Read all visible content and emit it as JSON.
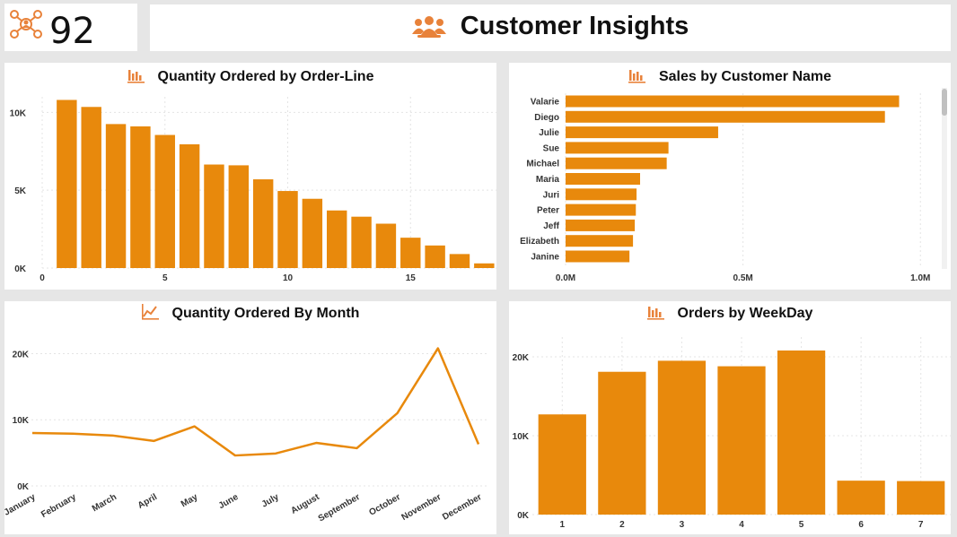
{
  "header": {
    "kpi_value": "92",
    "title": "Customer Insights"
  },
  "colors": {
    "bar": "#e8890c",
    "grid": "#e4e4e4",
    "text": "#333333",
    "icon": "#e8823a"
  },
  "icons": {
    "kpi": "network-people-icon",
    "title": "team-icon",
    "chart": "bar-chart-icon",
    "line": "line-chart-icon"
  },
  "chart_data": [
    {
      "id": "qty-orderline",
      "type": "bar",
      "title": "Quantity Ordered by Order-Line",
      "x": [
        1,
        2,
        3,
        4,
        5,
        6,
        7,
        8,
        9,
        10,
        11,
        12,
        13,
        14,
        15,
        16,
        17,
        18
      ],
      "values": [
        10800,
        10350,
        9250,
        9100,
        8550,
        7950,
        6650,
        6600,
        5700,
        4950,
        4450,
        3700,
        3300,
        2850,
        1950,
        1450,
        900,
        300
      ],
      "xlim": [
        0,
        18.5
      ],
      "ylim": [
        0,
        11000
      ],
      "xticks": [
        0,
        5,
        10,
        15
      ],
      "yticks": [
        {
          "v": 0,
          "label": "0K"
        },
        {
          "v": 5000,
          "label": "5K"
        },
        {
          "v": 10000,
          "label": "10K"
        }
      ],
      "grid": true
    },
    {
      "id": "sales-customer",
      "type": "bar",
      "orientation": "horizontal",
      "title": "Sales by Customer Name",
      "categories": [
        "Valarie",
        "Diego",
        "Julie",
        "Sue",
        "Michael",
        "Maria",
        "Juri",
        "Peter",
        "Jeff",
        "Elizabeth",
        "Janine"
      ],
      "values": [
        0.94,
        0.9,
        0.43,
        0.29,
        0.285,
        0.21,
        0.2,
        0.198,
        0.195,
        0.19,
        0.18
      ],
      "unit": "M",
      "xlim": [
        0,
        1.05
      ],
      "xticks": [
        {
          "v": 0,
          "label": "0.0M"
        },
        {
          "v": 0.5,
          "label": "0.5M"
        },
        {
          "v": 1.0,
          "label": "1.0M"
        }
      ],
      "grid": true
    },
    {
      "id": "qty-month",
      "type": "line",
      "title": "Quantity Ordered By Month",
      "categories": [
        "January",
        "February",
        "March",
        "April",
        "May",
        "June",
        "July",
        "August",
        "September",
        "October",
        "November",
        "December"
      ],
      "values": [
        8000,
        7900,
        7600,
        6800,
        9000,
        4600,
        4900,
        6500,
        5700,
        11000,
        20800,
        6300
      ],
      "ylim": [
        0,
        22500
      ],
      "yticks": [
        {
          "v": 0,
          "label": "0K"
        },
        {
          "v": 10000,
          "label": "10K"
        },
        {
          "v": 20000,
          "label": "20K"
        }
      ],
      "grid": true
    },
    {
      "id": "orders-weekday",
      "type": "bar",
      "title": "Orders by WeekDay",
      "categories": [
        "1",
        "2",
        "3",
        "4",
        "5",
        "6",
        "7"
      ],
      "values": [
        12700,
        18100,
        19500,
        18800,
        20800,
        4300,
        4250
      ],
      "ylim": [
        0,
        22500
      ],
      "yticks": [
        {
          "v": 0,
          "label": "0K"
        },
        {
          "v": 10000,
          "label": "10K"
        },
        {
          "v": 20000,
          "label": "20K"
        }
      ],
      "grid": true
    }
  ]
}
